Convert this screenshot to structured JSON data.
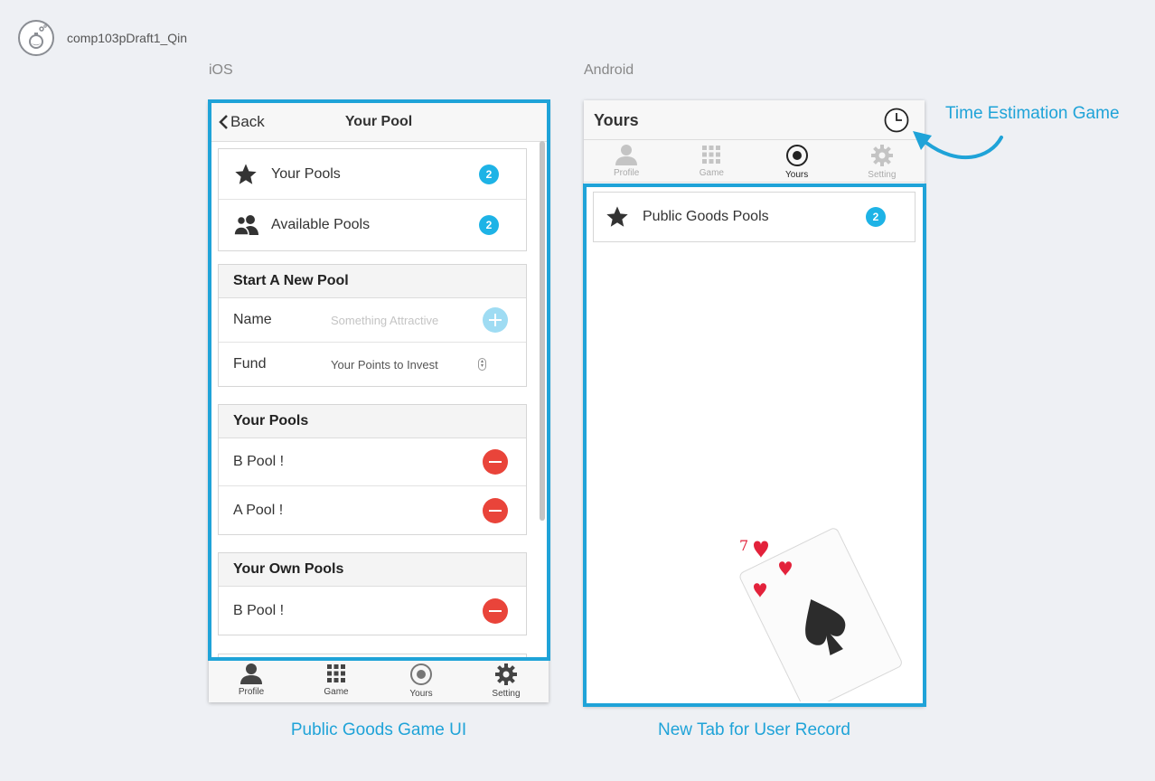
{
  "header": {
    "project_title": "comp103pDraft1_Qin"
  },
  "ios": {
    "platform_label": "iOS",
    "back_label": "Back",
    "nav_title": "Your Pool",
    "menu": [
      {
        "label": "Your Pools",
        "badge": "2",
        "icon": "star-icon"
      },
      {
        "label": "Available Pools",
        "badge": "2",
        "icon": "users-icon"
      }
    ],
    "new_pool": {
      "heading": "Start A New Pool",
      "name_label": "Name",
      "name_placeholder": "Something Attractive",
      "fund_label": "Fund",
      "fund_placeholder": "Your Points to Invest"
    },
    "your_pools": {
      "heading": "Your Pools",
      "items": [
        "B Pool !",
        "A Pool !"
      ]
    },
    "own_pools": {
      "heading": "Your Own Pools",
      "items": [
        "B Pool !"
      ]
    },
    "tabs": [
      "Profile",
      "Game",
      "Yours",
      "Setting"
    ],
    "caption": "Public Goods Game UI"
  },
  "android": {
    "platform_label": "Android",
    "title": "Yours",
    "tabs": [
      "Profile",
      "Game",
      "Yours",
      "Setting"
    ],
    "list_item": {
      "label": "Public Goods Pools",
      "badge": "2"
    },
    "annotation": "Time Estimation Game",
    "caption": "New Tab for User Record"
  },
  "colors": {
    "accent": "#1fa3d8",
    "badge": "#1eb3e6",
    "danger": "#e9443a"
  }
}
